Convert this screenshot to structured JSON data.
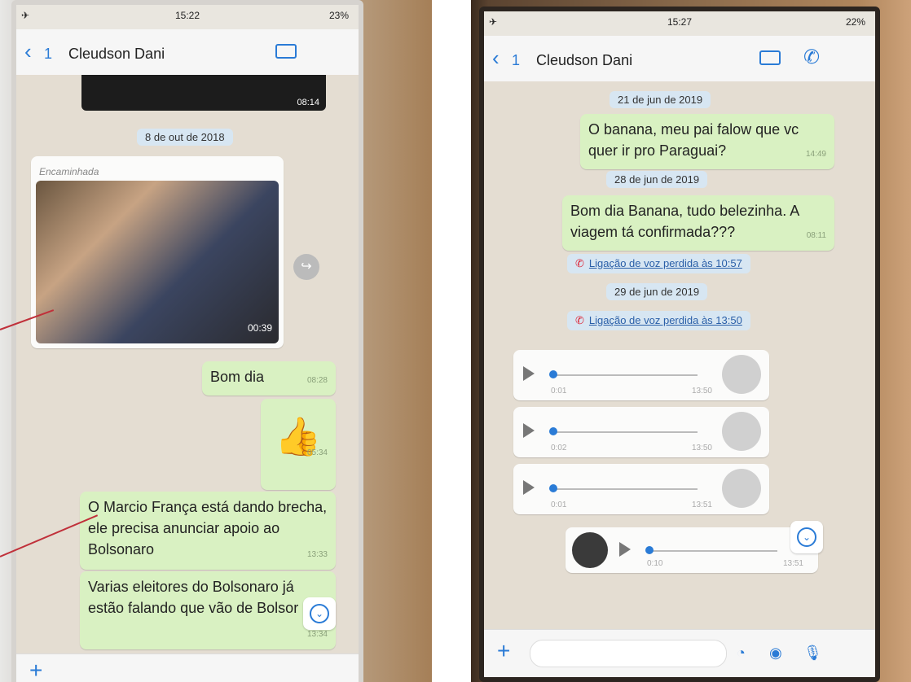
{
  "left": {
    "status_time": "15:22",
    "battery": "23%",
    "back_count": "1",
    "contact": "Cleudson Dani",
    "video_time": "08:14",
    "date_label": "8 de out de 2018",
    "forwarded": "Encaminhada",
    "photo_time": "00:39",
    "messages": [
      {
        "text": "Bom dia",
        "time": "08:28"
      },
      {
        "text": "👍",
        "time": "05:34"
      },
      {
        "text": "O Marcio França está dando brecha, ele precisa anunciar apoio ao Bolsonaro",
        "time": "13:33"
      },
      {
        "text": "Varias eleitores do Bolsonaro já estão falando que vão de Bolsor",
        "time": "13:34"
      }
    ]
  },
  "right": {
    "status_time": "15:27",
    "battery": "22%",
    "back_count": "1",
    "contact": "Cleudson Dani",
    "date1": "21 de jun de 2019",
    "msg1": {
      "text": "O banana, meu pai falow que vc quer ir pro Paraguai?",
      "time": "14:49"
    },
    "date2": "28 de jun de 2019",
    "msg2": {
      "text": "Bom dia Banana, tudo belezinha. A viagem tá confirmada???",
      "time": "08:11"
    },
    "missed1": "Ligação de voz perdida às 10:57",
    "date3": "29 de jun de 2019",
    "missed2": "Ligação de voz perdida às 13:50",
    "audio": [
      {
        "dur": "0:01",
        "time": "13:50"
      },
      {
        "dur": "0:02",
        "time": "13:50"
      },
      {
        "dur": "0:01",
        "time": "13:51"
      }
    ],
    "audio_out": {
      "dur": "0:10",
      "time": "13:51"
    }
  }
}
